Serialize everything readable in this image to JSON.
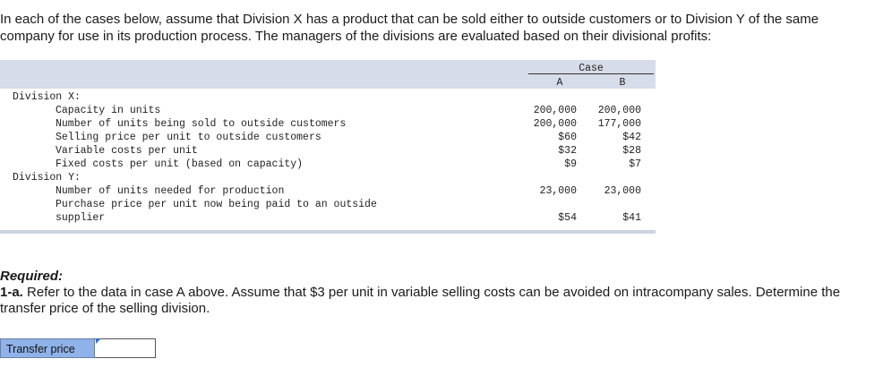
{
  "intro": "In each of the cases below, assume that Division X has a product that can be sold either to outside customers or to Division Y of the same company for use in its production process. The managers of the divisions are evaluated based on their divisional profits:",
  "table": {
    "case_label": "Case",
    "col_a": "A",
    "col_b": "B",
    "rows": [
      {
        "label": "Division X:",
        "a": "",
        "b": ""
      },
      {
        "label": "Capacity in units",
        "a": "200,000",
        "b": "200,000"
      },
      {
        "label": "Number of units being sold to outside customers",
        "a": "200,000",
        "b": "177,000"
      },
      {
        "label": "Selling price per unit to outside customers",
        "a": "$60",
        "b": "$42"
      },
      {
        "label": "Variable costs per unit",
        "a": "$32",
        "b": "$28"
      },
      {
        "label": "Fixed costs per unit (based on capacity)",
        "a": "$9",
        "b": "$7"
      },
      {
        "label": "Division Y:",
        "a": "",
        "b": ""
      },
      {
        "label": "Number of units needed for production",
        "a": "23,000",
        "b": "23,000"
      },
      {
        "label": "Purchase price per unit now being paid to an outside supplier",
        "a": "$54",
        "b": "$41"
      }
    ]
  },
  "required": {
    "title": "Required:",
    "question_number": "1-a.",
    "question_text": "Refer to the data in case A above. Assume that $3 per unit in variable selling costs can be avoided on intracompany sales. Determine the transfer price of the selling division."
  },
  "answer": {
    "label": "Transfer price",
    "value": ""
  }
}
